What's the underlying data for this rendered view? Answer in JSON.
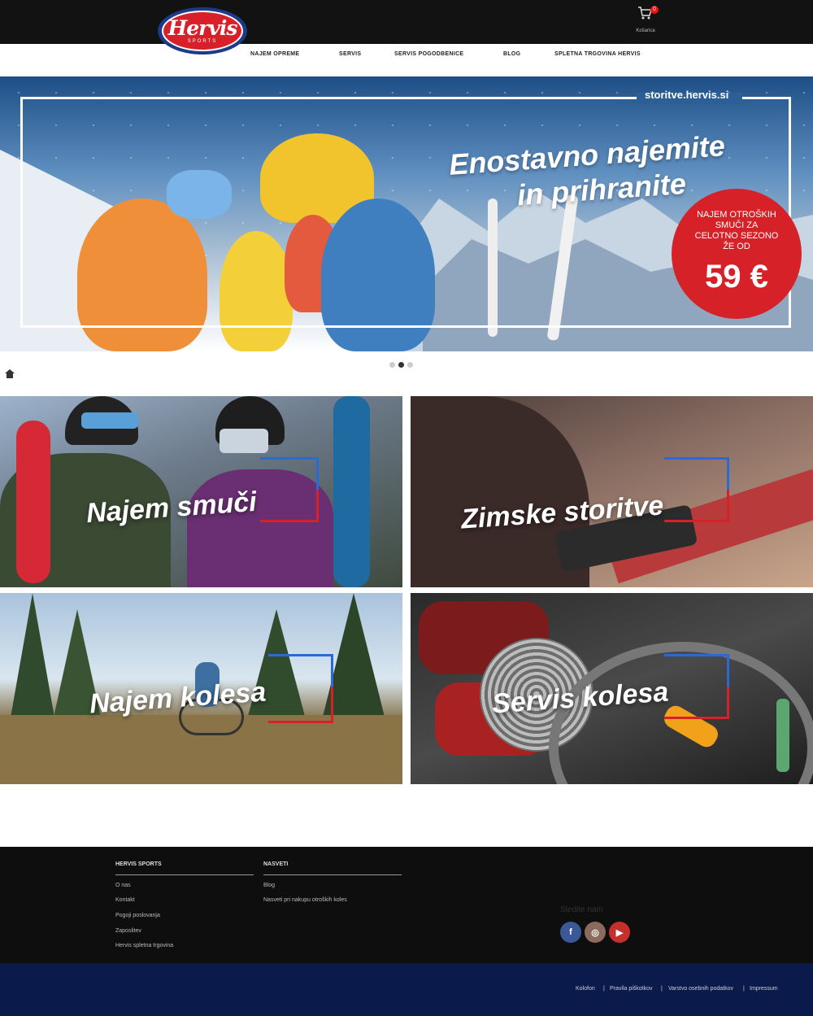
{
  "header": {
    "logo_text": "Hervis",
    "logo_sub": "SPORTS",
    "cart_count": "0",
    "cart_label": "Košarica"
  },
  "nav": {
    "items": [
      {
        "label": "Najem opreme"
      },
      {
        "label": "Servis"
      },
      {
        "label": "Servis pogodbenice"
      },
      {
        "label": "Blog"
      },
      {
        "label": "Spletna trgovina Hervis"
      }
    ]
  },
  "hero": {
    "url": "storitve.hervis.si",
    "title_line1": "Enostavno najemite",
    "title_line2": "in prihranite",
    "badge_text": "Najem otroških smuči za celotno sezono že od",
    "badge_price": "59 €",
    "slides": 3,
    "active_slide": 2
  },
  "tiles": [
    {
      "title": "Najem smuči"
    },
    {
      "title": "Zimske storitve"
    },
    {
      "title": "Najem kolesa"
    },
    {
      "title": "Servis kolesa"
    }
  ],
  "footer": {
    "col1": {
      "heading": "Hervis Sports",
      "links": [
        "O nas",
        "Kontakt",
        "Pogoji poslovanja",
        "Zaposlitev",
        "Hervis spletna trgovina"
      ]
    },
    "col2": {
      "heading": "Nasveti",
      "links": [
        "Blog",
        "Nasveti pri nakupu otroških koles"
      ]
    },
    "follow_label": "Sledite nam",
    "social": [
      {
        "icon": "facebook-icon",
        "glyph": "f",
        "color": "#3b5998"
      },
      {
        "icon": "instagram-icon",
        "glyph": "◎",
        "color": "#8a6a5a"
      },
      {
        "icon": "youtube-icon",
        "glyph": "▶",
        "color": "#c4302b"
      }
    ]
  },
  "bottom": {
    "links": [
      "Kolofon",
      "Pravila piškotkov",
      "Varstvo osebnih podatkov",
      "Impressum"
    ]
  },
  "colors": {
    "header_bg": "#121212",
    "accent_red": "#d72128",
    "brand_blue": "#1b3a8a",
    "footer_bg": "#0e0e0e",
    "bottom_bg": "#0a1a4a"
  }
}
